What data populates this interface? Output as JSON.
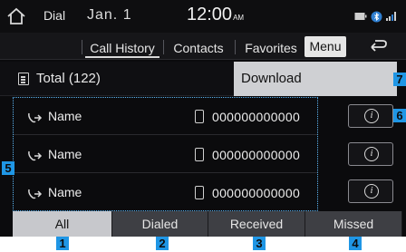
{
  "status": {
    "date": "Jan.  1",
    "time": "12:00",
    "time_suffix": "AM",
    "icons": [
      "home-icon",
      "battery-icon",
      "bluetooth-icon",
      "signal-icon"
    ]
  },
  "tabs": [
    {
      "label": "Dial",
      "active": false
    },
    {
      "label": "Call History",
      "active": true
    },
    {
      "label": "Contacts",
      "active": false
    },
    {
      "label": "Favorites",
      "active": false
    }
  ],
  "header": {
    "menu_label": "Menu",
    "back_icon": "back-arrow-icon"
  },
  "total": {
    "label": "Total (122)",
    "icon": "list-icon"
  },
  "dropdown": {
    "download_label": "Download"
  },
  "calls": [
    {
      "name": "Name",
      "number": "000000000000",
      "type_icon": "outgoing-call-icon"
    },
    {
      "name": "Name",
      "number": "000000000000",
      "type_icon": "outgoing-call-icon"
    },
    {
      "name": "Name",
      "number": "000000000000",
      "type_icon": "outgoing-call-icon"
    }
  ],
  "info_button": {
    "glyph": "i"
  },
  "filters": [
    {
      "label": "All",
      "active": true
    },
    {
      "label": "Dialed",
      "active": false
    },
    {
      "label": "Received",
      "active": false
    },
    {
      "label": "Missed",
      "active": false
    }
  ],
  "markers": {
    "m1": "1",
    "m2": "2",
    "m3": "3",
    "m4": "4",
    "m5": "5",
    "m6": "6",
    "m7": "7"
  },
  "colors": {
    "marker": "#1f96e5",
    "background": "#0b0b0d",
    "active_filter": "#c7c8cc",
    "inactive_filter": "#3e3f44"
  }
}
